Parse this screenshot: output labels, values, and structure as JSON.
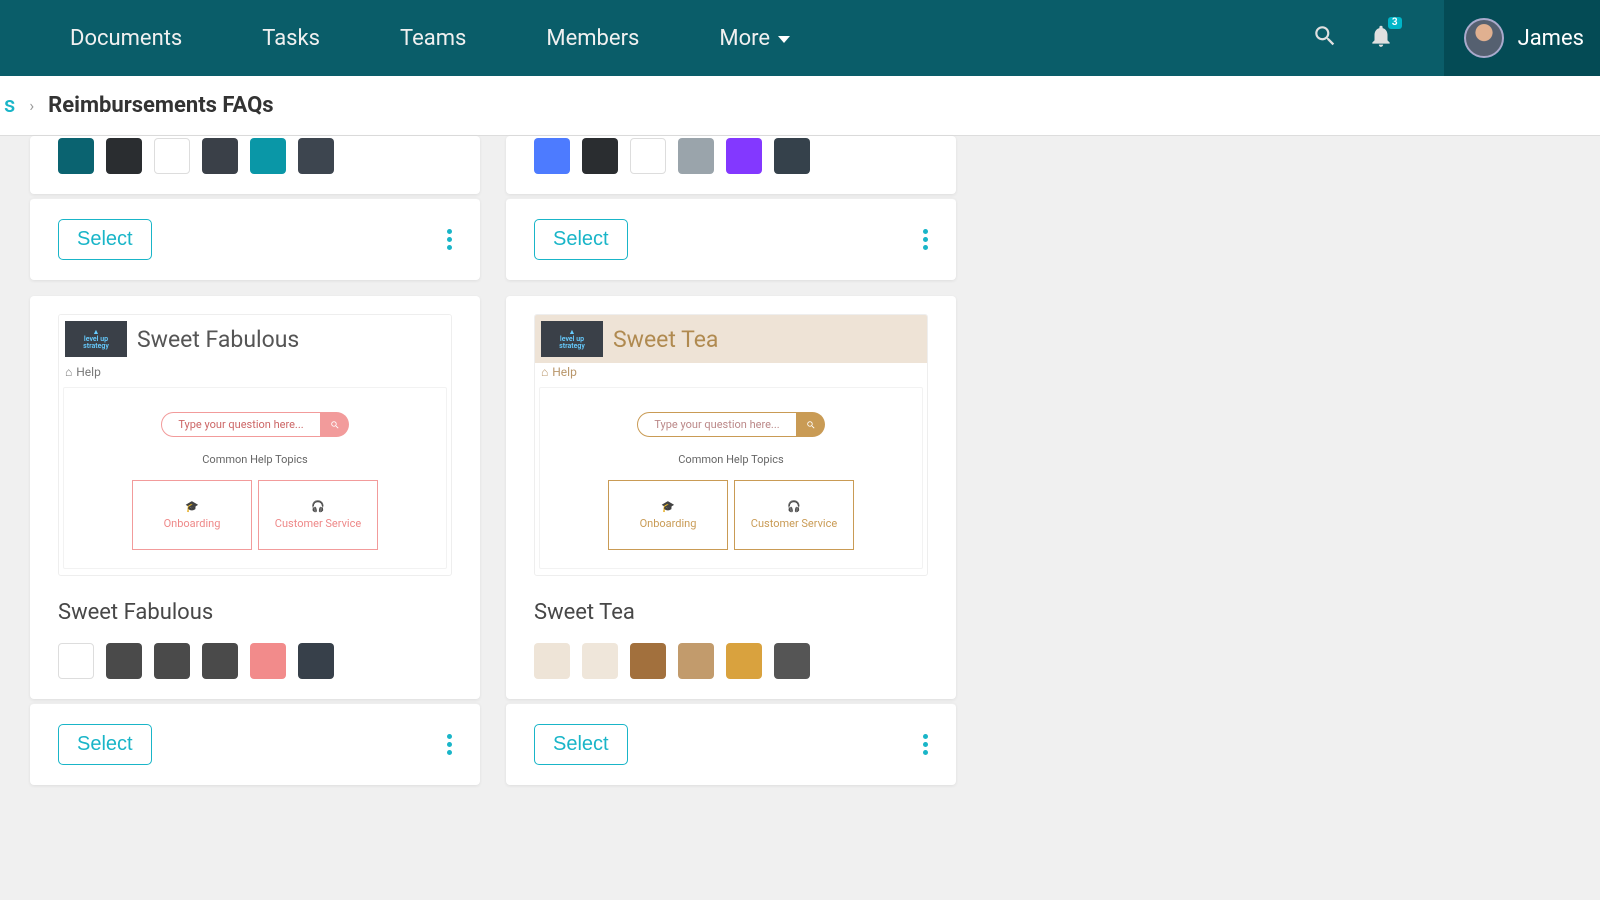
{
  "header": {
    "nav": [
      "Documents",
      "Tasks",
      "Teams",
      "Members",
      "More"
    ],
    "notification_count": "3",
    "username": "James"
  },
  "breadcrumb": {
    "prev_suffix": "s",
    "current": "Reimbursements FAQs"
  },
  "preview_common": {
    "home_label": "Help",
    "search_placeholder": "Type your question here...",
    "common_topics_label": "Common Help Topics",
    "topic_onboarding": "Onboarding",
    "topic_customer_service": "Customer Service"
  },
  "select_label": "Select",
  "themes": {
    "top_left": {
      "swatches": [
        "#0a6370",
        "#2a2d30",
        "#ffffff",
        "#3a4048",
        "#0a97a7",
        "#3d454f"
      ]
    },
    "top_right": {
      "swatches": [
        "#4d7bff",
        "#2a2d30",
        "#ffffff",
        "#9aa4ab",
        "#8338ff",
        "#35414b"
      ]
    },
    "sweet_fabulous": {
      "title": "Sweet Fabulous",
      "name": "Sweet Fabulous",
      "swatches": [
        "#ffffff",
        "#4a4a4a",
        "#4a4a4a",
        "#4a4a4a",
        "#f28b8b",
        "#37404a"
      ]
    },
    "sweet_tea": {
      "title": "Sweet Tea",
      "name": "Sweet Tea",
      "swatches": [
        "#eee4d7",
        "#efe6da",
        "#a2703d",
        "#c29b6c",
        "#d9a23e",
        "#555555"
      ]
    }
  }
}
